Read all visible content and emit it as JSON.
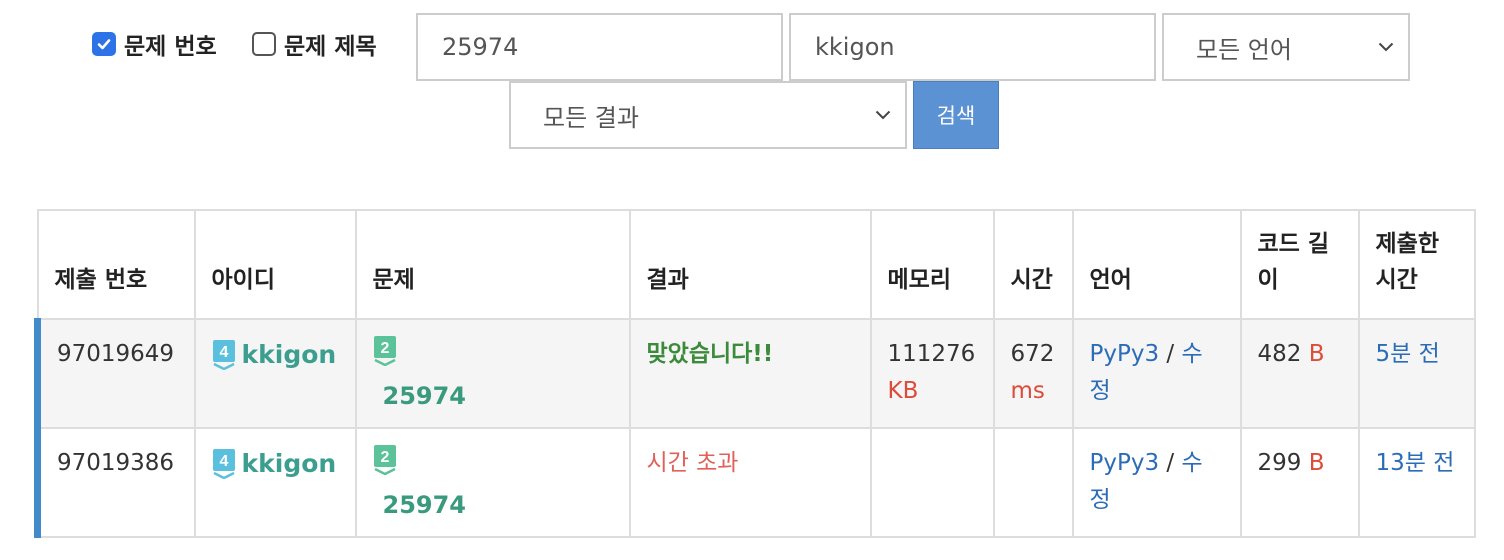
{
  "search": {
    "filters": [
      {
        "label": "문제 번호",
        "checked": true
      },
      {
        "label": "문제 제목",
        "checked": false
      }
    ],
    "problem_value": "25974",
    "user_value": "kkigon",
    "language_select": "모든 언어",
    "result_select": "모든 결과",
    "search_button": "검색"
  },
  "table": {
    "headers": [
      "제출 번호",
      "아이디",
      "문제",
      "결과",
      "메모리",
      "시간",
      "언어",
      "코드 길이",
      "제출한 시간"
    ],
    "rows": [
      {
        "submission_id": "97019649",
        "user_tier": "4",
        "user": "kkigon",
        "problem_tier": "2",
        "problem": "25974",
        "result": "맞았습니다!!",
        "memory": "111276",
        "memory_unit": "KB",
        "time": "672",
        "time_unit": "ms",
        "language": "PyPy3",
        "separator": "/",
        "edit": "수정",
        "code_length": "482",
        "code_unit": "B",
        "submitted": "5분 전"
      },
      {
        "submission_id": "97019386",
        "user_tier": "4",
        "user": "kkigon",
        "problem_tier": "2",
        "problem": "25974",
        "result": "시간 초과",
        "memory": "",
        "memory_unit": "",
        "time": "",
        "time_unit": "",
        "language": "PyPy3",
        "separator": "/",
        "edit": "수정",
        "code_length": "299",
        "code_unit": "B",
        "submitted": "13분 전"
      }
    ]
  },
  "colors": {
    "accent": "#428bca",
    "correct": "#3c8a3c",
    "time_limit_exceeded": "#e0605a",
    "unit": "#dd4b39",
    "tier": "#5bc0de"
  },
  "icons": {
    "tier_badge": "tier-badge-icon",
    "chevron": "chevron-down-icon",
    "checkmark": "checkmark-icon"
  }
}
